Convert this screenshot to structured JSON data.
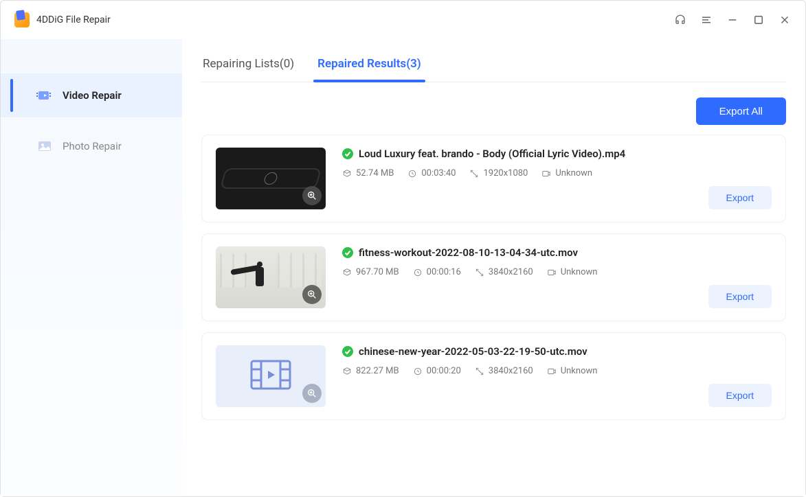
{
  "app": {
    "title": "4DDiG File Repair"
  },
  "sidebar": {
    "items": [
      {
        "label": "Video Repair"
      },
      {
        "label": "Photo Repair"
      }
    ]
  },
  "tabs": {
    "repairing": {
      "label": "Repairing Lists",
      "count": "(0)"
    },
    "results": {
      "label": "Repaired Results",
      "count": "(3)"
    }
  },
  "actions": {
    "export_all": "Export All",
    "export": "Export"
  },
  "files": [
    {
      "name": "Loud Luxury feat. brando - Body (Official Lyric Video).mp4",
      "size": "52.74 MB",
      "duration": "00:03:40",
      "resolution": "1920x1080",
      "codec": "Unknown"
    },
    {
      "name": "fitness-workout-2022-08-10-13-04-34-utc.mov",
      "size": "967.70 MB",
      "duration": "00:00:16",
      "resolution": "3840x2160",
      "codec": "Unknown"
    },
    {
      "name": "chinese-new-year-2022-05-03-22-19-50-utc.mov",
      "size": "822.27 MB",
      "duration": "00:00:20",
      "resolution": "3840x2160",
      "codec": "Unknown"
    }
  ]
}
